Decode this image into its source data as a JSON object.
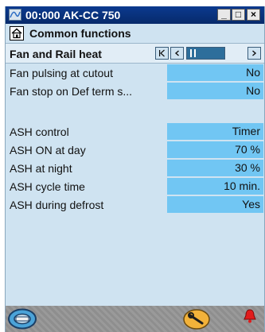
{
  "window": {
    "title": "00:000 AK-CC 750",
    "minimize": "_",
    "maximize": "□",
    "close": "×"
  },
  "header": {
    "title": "Common functions"
  },
  "subheader": {
    "title": "Fan and Rail heat"
  },
  "nav": {
    "first": "|<",
    "prev": "<",
    "next": ">"
  },
  "rows": [
    {
      "label": "Fan pulsing at cutout",
      "value": "No"
    },
    {
      "label": "Fan stop on Def term s...",
      "value": "No"
    },
    {
      "label": "ASH control",
      "value": "Timer"
    },
    {
      "label": "ASH ON at day",
      "value": "70 %"
    },
    {
      "label": "ASH at night",
      "value": "30 %"
    },
    {
      "label": "ASH cycle time",
      "value": "10 min."
    },
    {
      "label": "ASH during defrost",
      "value": "Yes"
    }
  ],
  "footer": {
    "left_icon": "disc-icon",
    "center_icon": "wrench-icon",
    "right_icon": "alarm-bell-icon"
  },
  "colors": {
    "titlebar": "#0b3a8f",
    "panel": "#cfe3f1",
    "value_field": "#71c6f3"
  }
}
